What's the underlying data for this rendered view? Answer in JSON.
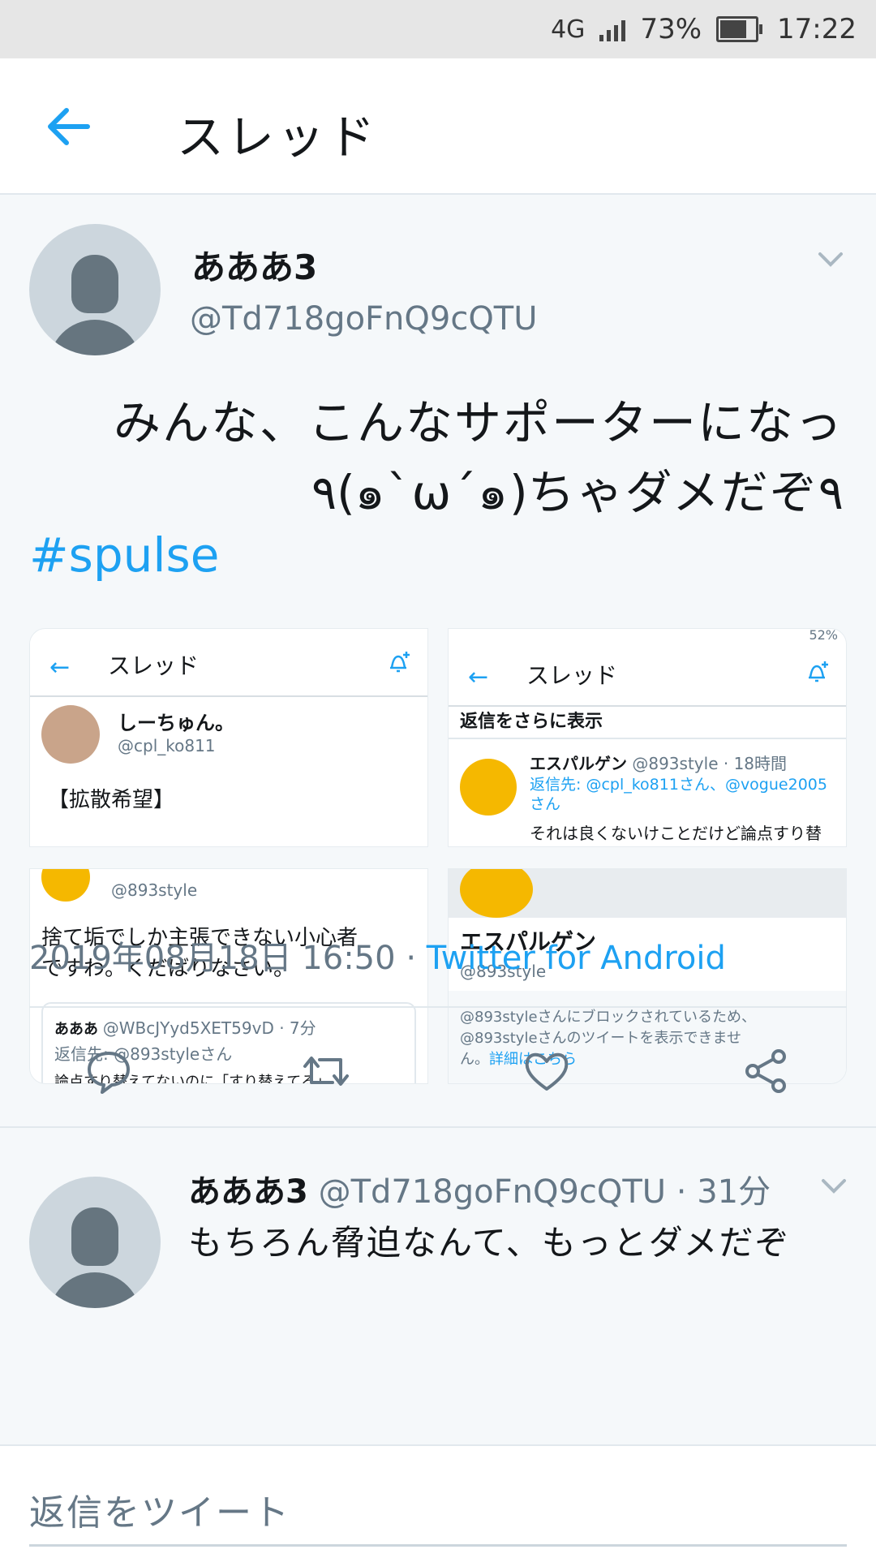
{
  "status": {
    "network": "4G",
    "battery": "73%",
    "time": "17:22"
  },
  "appbar": {
    "title": "スレッド"
  },
  "tweet": {
    "name": "あああ3",
    "handle": "@Td718goFnQ9cQTU",
    "text_line1": "みんな、こんなサポーターになっ",
    "text_line2": "٩(๑`ω´๑)ちゃダメだぞ۹",
    "hashtag": "#spulse",
    "timestamp": "2019年08月18日 16:50",
    "separator": "·",
    "via": "Twitter for Android"
  },
  "media": {
    "s1": {
      "title": "スレッド",
      "name": "しーちゅん。",
      "handle": "@cpl_ko811",
      "text": "【拡散希望】"
    },
    "s2": {
      "title": "スレッド",
      "status": "52%",
      "more": "返信をさらに表示",
      "name": "エスパルゲン",
      "meta": "@893style · 18時間",
      "reply_to": "返信先: @cpl_ko811さん、@vogue2005さん",
      "text": "それは良くないけことだけど論点すり替"
    },
    "s3": {
      "handle": "@893style",
      "text1": "捨て垢でしか主張できない小心者",
      "text2": "ですわ。くだばりなさい。",
      "q_name": "あああ",
      "q_handle": "@WBcJYyd5XET59vD · 7分",
      "q_reply": "返信先: @893styleさん",
      "q_text": "論点すり替えてないのに「すり替えてる」"
    },
    "s4": {
      "name": "エスパルゲン",
      "handle": "@893style",
      "blocked1": "@893styleさんにブロックされているため、",
      "blocked2": "@893styleさんのツイートを表示できませ",
      "blocked3": "ん。",
      "details": "詳細はこちら"
    }
  },
  "reply": {
    "name": "あああ3",
    "handle": "@Td718goFnQ9cQTU · 31分",
    "text": "もちろん脅迫なんて、もっとダメだぞ"
  },
  "compose": {
    "placeholder": "返信をツイート"
  },
  "colors": {
    "accent": "#1da1f2",
    "secondary": "#657786",
    "background": "#f5f8fa"
  }
}
